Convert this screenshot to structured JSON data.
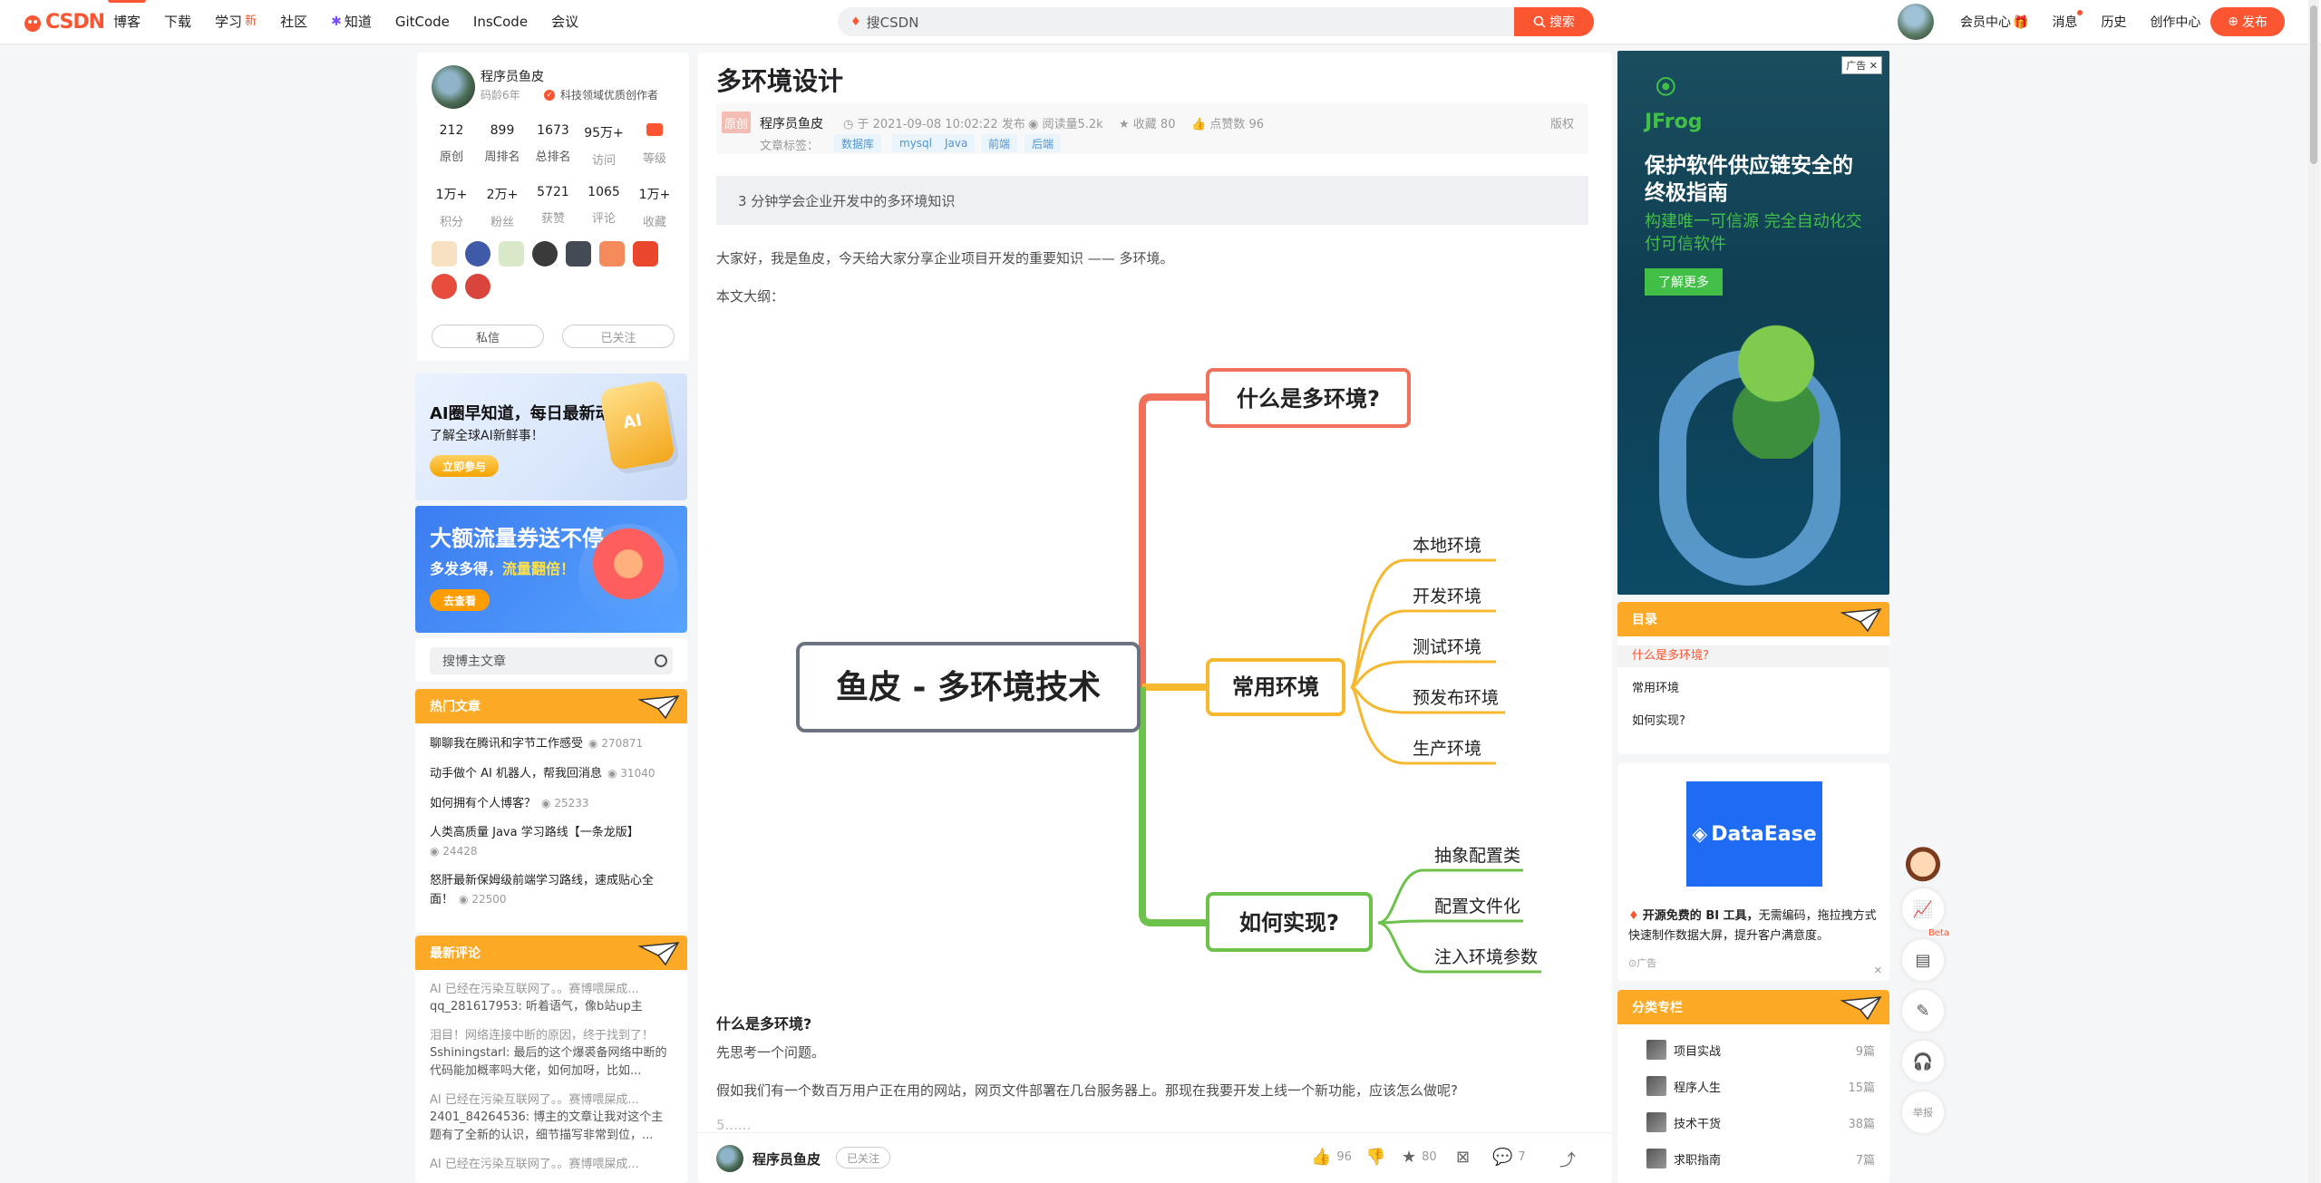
{
  "nav": {
    "logo": "CSDN",
    "links": [
      {
        "label": "博客",
        "active": true
      },
      {
        "label": "下载"
      },
      {
        "label": "学习",
        "badge": "新"
      },
      {
        "label": "社区"
      },
      {
        "label": "知道",
        "icon": "spark-icon"
      },
      {
        "label": "GitCode"
      },
      {
        "label": "InsCode"
      },
      {
        "label": "会议"
      }
    ],
    "search_placeholder": "搜CSDN",
    "search_button": "搜索",
    "user_links": [
      "会员中心",
      "消息",
      "历史",
      "创作中心"
    ],
    "publish": "发布"
  },
  "profile": {
    "name": "程序员鱼皮",
    "code_age": "码龄6年",
    "cert": "科技领域优质创作者",
    "stats1": [
      {
        "v": "212",
        "l": "原创"
      },
      {
        "v": "899",
        "l": "周排名"
      },
      {
        "v": "1673",
        "l": "总排名"
      },
      {
        "v": "95万+",
        "l": "访问"
      },
      {
        "v": "",
        "l": "等级"
      }
    ],
    "stats2": [
      {
        "v": "1万+",
        "l": "积分"
      },
      {
        "v": "2万+",
        "l": "粉丝"
      },
      {
        "v": "5721",
        "l": "获赞"
      },
      {
        "v": "1065",
        "l": "评论"
      },
      {
        "v": "1万+",
        "l": "收藏"
      }
    ],
    "btn_message": "私信",
    "btn_follow": "已关注"
  },
  "promo1": {
    "title": "AI圈早知道，每日最新动态",
    "sub": "了解全球AI新鲜事！",
    "cta": "立即参与",
    "cube": "AI"
  },
  "promo2": {
    "title": "大额流量券送不停",
    "sub_a": "多发多得，",
    "sub_b": "流量翻倍！",
    "cta": "去查看"
  },
  "blog_search": {
    "placeholder": "搜博主文章"
  },
  "hot": {
    "title": "热门文章",
    "items": [
      {
        "t": "聊聊我在腾讯和字节工作感受",
        "v": "270871"
      },
      {
        "t": "动手做个 AI 机器人，帮我回消息",
        "v": "31040"
      },
      {
        "t": "如何拥有个人博客？",
        "v": "25233"
      },
      {
        "t": "人类高质量 Java 学习路线【一条龙版】",
        "v": "24428"
      },
      {
        "t": "怒肝最新保姆级前端学习路线，速成贴心全面！",
        "v": "22500"
      }
    ]
  },
  "comments": {
    "title": "最新评论",
    "items": [
      {
        "a": "AI 已经在污染互联网了。。赛博喂屎成...",
        "b": "qq_281617953: 听着语气，像b站up主"
      },
      {
        "a": "泪目！网络连接中断的原因，终于找到了！",
        "b": "Sshiningstarl: 最后的这个爆裘备网络中断的代码能加概率吗大佬，如何加呀，比如..."
      },
      {
        "a": "AI 已经在污染互联网了。。赛博喂屎成...",
        "b": "2401_84264536: 博主的文章让我对这个主题有了全新的认识，细节描写非常到位，..."
      },
      {
        "a": "AI 已经在污染互联网了。。赛博喂屎成...",
        "b": ""
      }
    ]
  },
  "article": {
    "title": "多环境设计",
    "original": "原创",
    "author": "程序员鱼皮",
    "date": "于 2021-09-08 10:02:22 发布",
    "reads": "阅读量5.2k",
    "favs": "收藏 80",
    "likes": "点赞数 96",
    "copyright": "版权",
    "tags_label": "文章标签：",
    "tags": [
      "数据库",
      "mysql",
      "Java",
      "前端",
      "后端"
    ],
    "summary": "3 分钟学会企业开发中的多环境知识",
    "p1": "大家好，我是鱼皮，今天给大家分享企业项目开发的重要知识 —— 多环境。",
    "p2": "本文大纲：",
    "h3": "什么是多环境?",
    "p3": "先思考一个问题。",
    "p4": "假如我们有一个数百万用户正在用的网站，网页文件部署在几台服务器上。那现在我要开发上线一个新功能，应该怎么做呢?",
    "p5": "5......"
  },
  "mindmap": {
    "root": "鱼皮 - 多环境技术",
    "b1": "什么是多环境?",
    "b2": "常用环境",
    "b2_items": [
      "本地环境",
      "开发环境",
      "测试环境",
      "预发布环境",
      "生产环境"
    ],
    "b3": "如何实现?",
    "b3_items": [
      "抽象配置类",
      "配置文件化",
      "注入环境参数"
    ],
    "colors": {
      "red": "#f0705a",
      "yellow": "#f5b82e",
      "green": "#6cc24a",
      "root": "#6b7280"
    }
  },
  "bottom": {
    "author": "程序员鱼皮",
    "follow": "已关注",
    "likes": "96",
    "favs": "80",
    "comments": "7"
  },
  "ad": {
    "tag": "广告",
    "brand": "JFrog",
    "title": "保护软件供应链安全的终极指南",
    "sub": "构建唯一可信源 完全自动化交付可信软件",
    "cta": "了解更多"
  },
  "toc": {
    "title": "目录",
    "items": [
      "什么是多环境?",
      "常用环境",
      "如何实现?"
    ]
  },
  "dad": {
    "brand": "DataEase",
    "text_bold": "开源免费的 BI 工具，",
    "text": "无需编码，拖拉拽方式快速制作数据大屏，提升客户满意度。",
    "adlbl": "广告"
  },
  "cats": {
    "title": "分类专栏",
    "items": [
      {
        "n": "项目实战",
        "c": "9篇"
      },
      {
        "n": "程序人生",
        "c": "15篇"
      },
      {
        "n": "技术干货",
        "c": "38篇"
      },
      {
        "n": "求职指南",
        "c": "7篇"
      }
    ]
  },
  "float": {
    "beta": "Beta",
    "report": "举报"
  }
}
